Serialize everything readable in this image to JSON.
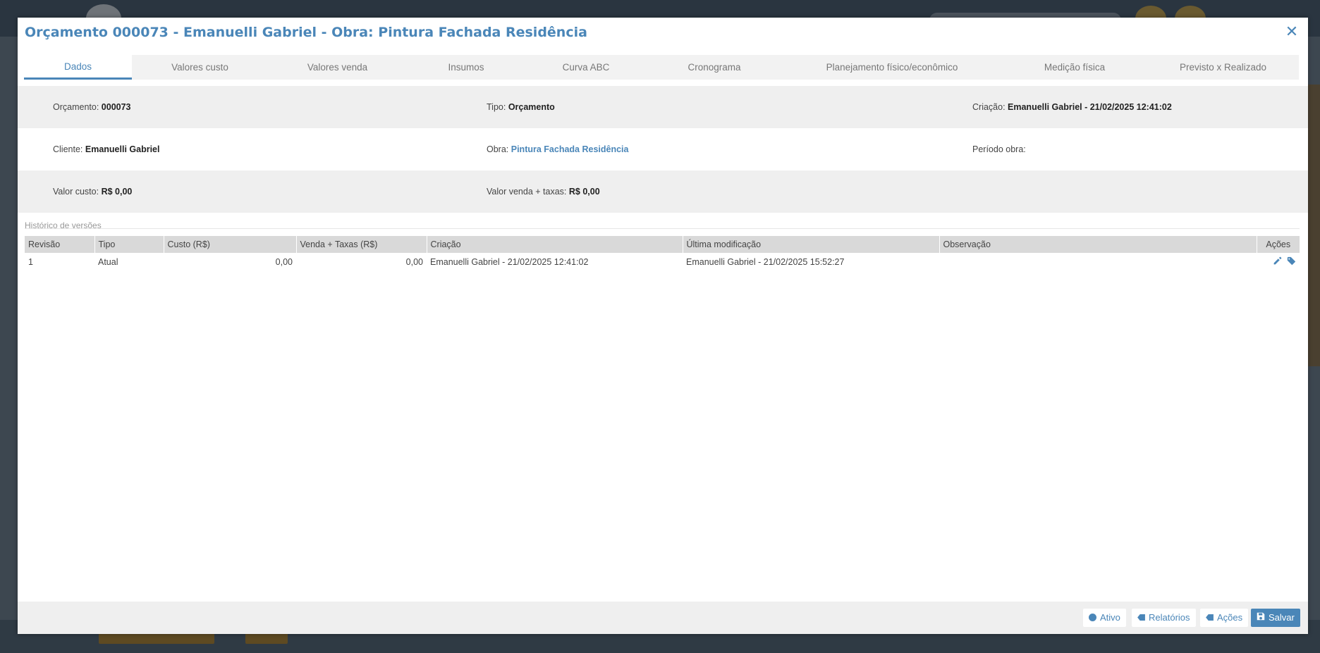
{
  "modal": {
    "title": "Orçamento 000073 - Emanuelli Gabriel - Obra: Pintura Fachada Residência",
    "close_label": "✕"
  },
  "tabs": [
    {
      "label": "Dados",
      "active": true
    },
    {
      "label": "Valores custo"
    },
    {
      "label": "Valores venda"
    },
    {
      "label": "Insumos"
    },
    {
      "label": "Curva ABC"
    },
    {
      "label": "Cronograma"
    },
    {
      "label": "Planejamento físico/econômico"
    },
    {
      "label": "Medição física"
    },
    {
      "label": "Previsto x Realizado"
    }
  ],
  "info": {
    "orcamento_label": "Orçamento:",
    "orcamento_value": "000073",
    "tipo_label": "Tipo:",
    "tipo_value": "Orçamento",
    "criacao_label": "Criação:",
    "criacao_value": "Emanuelli Gabriel - 21/02/2025 12:41:02",
    "cliente_label": "Cliente:",
    "cliente_value": "Emanuelli Gabriel",
    "obra_label": "Obra:",
    "obra_value": "Pintura Fachada Residência",
    "periodo_label": "Período obra:",
    "valor_custo_label": "Valor custo:",
    "valor_custo_value": "R$ 0,00",
    "valor_venda_label": "Valor venda + taxas:",
    "valor_venda_value": "R$ 0,00"
  },
  "history": {
    "title": "Histórico de versões",
    "columns": [
      "Revisão",
      "Tipo",
      "Custo (R$)",
      "Venda + Taxas (R$)",
      "Criação",
      "Última modificação",
      "Observação",
      "Ações"
    ],
    "rows": [
      {
        "revisao": "1",
        "tipo": "Atual",
        "custo": "0,00",
        "venda": "0,00",
        "criacao": "Emanuelli Gabriel - 21/02/2025 12:41:02",
        "ultima": "Emanuelli Gabriel - 21/02/2025 15:52:27",
        "observacao": ""
      }
    ]
  },
  "footer": {
    "ativo_label": "Ativo",
    "relatorios_label": "Relatórios",
    "acoes_label": "Ações",
    "salvar_label": "Salvar"
  },
  "colors": {
    "accent": "#4a86b8",
    "header_gray": "#d9d9d9",
    "row_shade": "#efefef"
  },
  "icons": [
    "close-icon",
    "pencil-icon",
    "tag-icon",
    "circle-icon",
    "report-icon",
    "actions-icon",
    "save-icon"
  ]
}
